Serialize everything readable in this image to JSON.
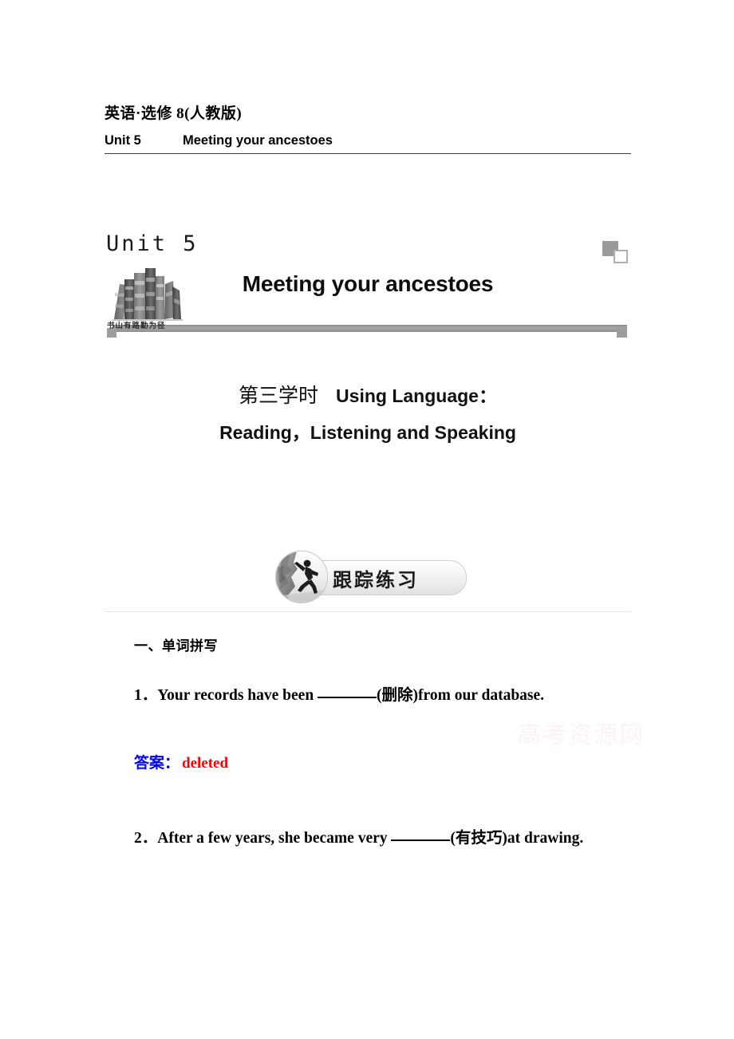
{
  "header": {
    "subject": "英语·选修 8(人教版)",
    "unit_label": "Unit 5",
    "unit_title": "Meeting your ancestoes"
  },
  "banner": {
    "unit_number": "Unit 5",
    "title": "Meeting your ancestoes",
    "books_caption": "书山有路勤为径",
    "decoration_color": "#9a9a9a",
    "bar_color": "#a6a6a6"
  },
  "section": {
    "period": "第三学时",
    "line1": "Using Language：",
    "line2": "Reading，Listening and Speaking"
  },
  "badge": {
    "text": "跟踪练习",
    "icon": "climber-icon"
  },
  "exercises": {
    "heading": "一、单词拼写",
    "items": [
      {
        "number": "1．",
        "text_before": "Your records have been ",
        "hint": "(删除)",
        "text_after": "from our database.",
        "answer_label": "答案：",
        "answer_value": "deleted",
        "answer_label_color": "#0000ff",
        "answer_value_color": "#ff0000"
      },
      {
        "number": "2．",
        "text_before": "After a few years, she became very ",
        "hint": "(有技巧)",
        "text_after": "at drawing."
      }
    ]
  },
  "watermark": {
    "text": "高考资源网",
    "color": "#fdf2f5"
  }
}
